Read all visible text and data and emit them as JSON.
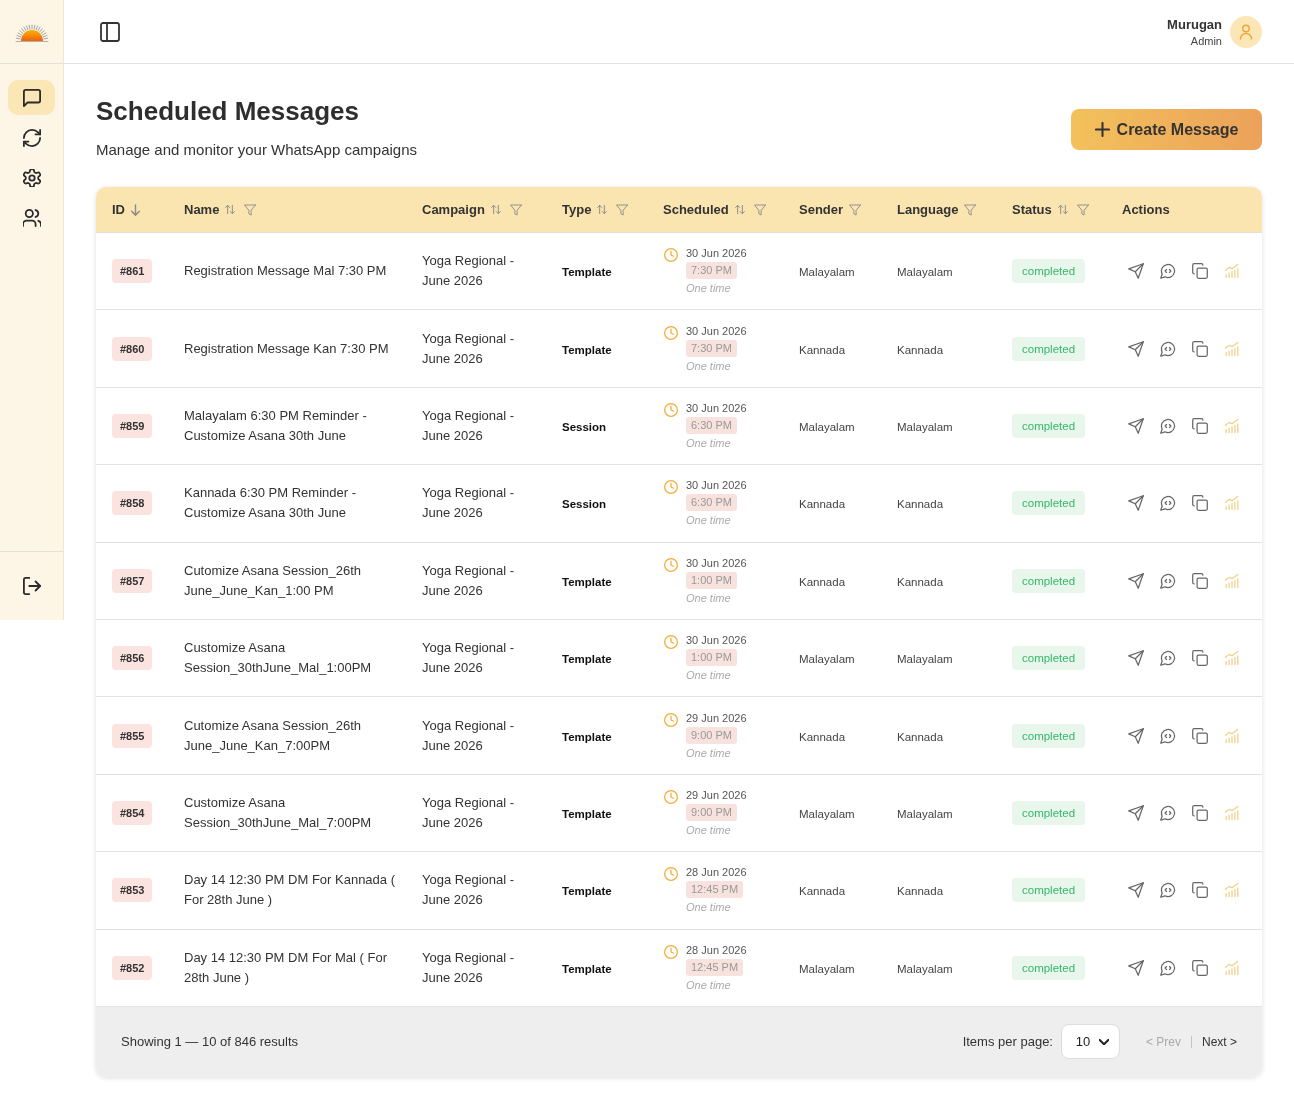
{
  "sidebar": {
    "nav_items": [
      {
        "kind": "chat",
        "selected": true
      },
      {
        "kind": "sync",
        "selected": false
      },
      {
        "kind": "settings",
        "selected": false
      },
      {
        "kind": "users",
        "selected": false
      }
    ]
  },
  "header": {
    "user": {
      "name": "Murugan",
      "role": "Admin"
    }
  },
  "page": {
    "title": "Scheduled Messages",
    "subtitle": "Manage and monitor your WhatsApp campaigns",
    "create_button": "Create Message"
  },
  "table": {
    "columns": [
      {
        "label": "ID",
        "sortable": true,
        "sorted": true,
        "filter": false
      },
      {
        "label": "Name",
        "sortable": true,
        "sorted": false,
        "filter": true
      },
      {
        "label": "Campaign",
        "sortable": true,
        "sorted": false,
        "filter": true
      },
      {
        "label": "Type",
        "sortable": true,
        "sorted": false,
        "filter": true
      },
      {
        "label": "Scheduled",
        "sortable": true,
        "sorted": false,
        "filter": true
      },
      {
        "label": "Sender",
        "sortable": false,
        "sorted": false,
        "filter": true
      },
      {
        "label": "Language",
        "sortable": false,
        "sorted": false,
        "filter": true
      },
      {
        "label": "Status",
        "sortable": true,
        "sorted": false,
        "filter": true
      },
      {
        "label": "Actions",
        "sortable": false,
        "sorted": false,
        "filter": false
      }
    ],
    "rows": [
      {
        "id": "#861",
        "name": "Registration Message Mal 7:30 PM",
        "campaign": "Yoga Regional - June 2026",
        "type": "Template",
        "date": "30 Jun 2026",
        "time": "7:30 PM",
        "recurrence": "One time",
        "sender": "Malayalam",
        "language": "Malayalam",
        "status": "completed"
      },
      {
        "id": "#860",
        "name": "Registration Message Kan 7:30 PM",
        "campaign": "Yoga Regional - June 2026",
        "type": "Template",
        "date": "30 Jun 2026",
        "time": "7:30 PM",
        "recurrence": "One time",
        "sender": "Kannada",
        "language": "Kannada",
        "status": "completed"
      },
      {
        "id": "#859",
        "name": "Malayalam 6:30 PM Reminder - Customize Asana 30th June",
        "campaign": "Yoga Regional - June 2026",
        "type": "Session",
        "date": "30 Jun 2026",
        "time": "6:30 PM",
        "recurrence": "One time",
        "sender": "Malayalam",
        "language": "Malayalam",
        "status": "completed"
      },
      {
        "id": "#858",
        "name": "Kannada 6:30 PM Reminder - Customize Asana 30th June",
        "campaign": "Yoga Regional - June 2026",
        "type": "Session",
        "date": "30 Jun 2026",
        "time": "6:30 PM",
        "recurrence": "One time",
        "sender": "Kannada",
        "language": "Kannada",
        "status": "completed"
      },
      {
        "id": "#857",
        "name": "Cutomize Asana Session_26th June_June_Kan_1:00 PM",
        "campaign": "Yoga Regional - June 2026",
        "type": "Template",
        "date": "30 Jun 2026",
        "time": "1:00 PM",
        "recurrence": "One time",
        "sender": "Kannada",
        "language": "Kannada",
        "status": "completed"
      },
      {
        "id": "#856",
        "name": "Customize Asana Session_30thJune_Mal_1:00PM",
        "campaign": "Yoga Regional - June 2026",
        "type": "Template",
        "date": "30 Jun 2026",
        "time": "1:00 PM",
        "recurrence": "One time",
        "sender": "Malayalam",
        "language": "Malayalam",
        "status": "completed"
      },
      {
        "id": "#855",
        "name": "Cutomize Asana Session_26th June_June_Kan_7:00PM",
        "campaign": "Yoga Regional - June 2026",
        "type": "Template",
        "date": "29 Jun 2026",
        "time": "9:00 PM",
        "recurrence": "One time",
        "sender": "Kannada",
        "language": "Kannada",
        "status": "completed"
      },
      {
        "id": "#854",
        "name": "Customize Asana Session_30thJune_Mal_7:00PM",
        "campaign": "Yoga Regional - June 2026",
        "type": "Template",
        "date": "29 Jun 2026",
        "time": "9:00 PM",
        "recurrence": "One time",
        "sender": "Malayalam",
        "language": "Malayalam",
        "status": "completed"
      },
      {
        "id": "#853",
        "name": "Day 14 12:30 PM DM For Kannada ( For 28th June )",
        "campaign": "Yoga Regional - June 2026",
        "type": "Template",
        "date": "28 Jun 2026",
        "time": "12:45 PM",
        "recurrence": "One time",
        "sender": "Kannada",
        "language": "Kannada",
        "status": "completed"
      },
      {
        "id": "#852",
        "name": "Day 14 12:30 PM DM For Mal ( For 28th June )",
        "campaign": "Yoga Regional - June 2026",
        "type": "Template",
        "date": "28 Jun 2026",
        "time": "12:45 PM",
        "recurrence": "One time",
        "sender": "Malayalam",
        "language": "Malayalam",
        "status": "completed"
      }
    ]
  },
  "pagination": {
    "summary": "Showing 1 — 10 of 846 results",
    "per_page_label": "Items per page:",
    "per_page": "10",
    "prev": {
      "label": "< Prev",
      "disabled": true
    },
    "next": {
      "label": "Next >",
      "disabled": false
    }
  }
}
